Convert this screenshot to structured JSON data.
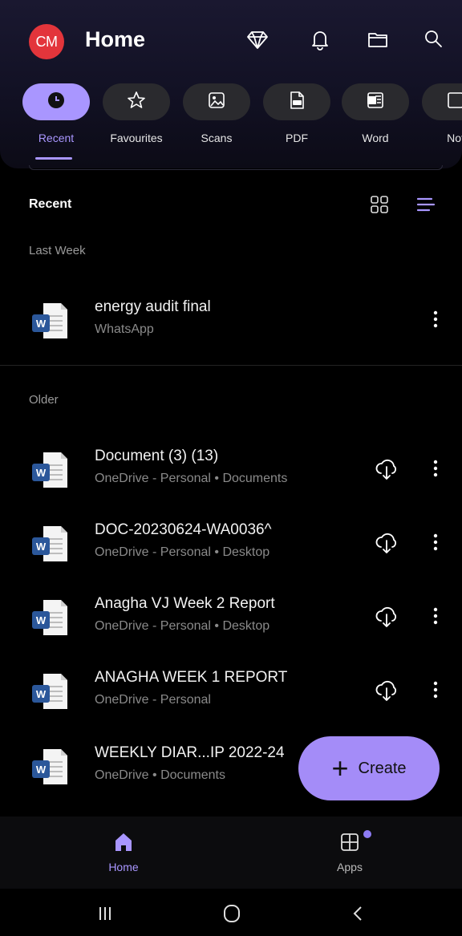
{
  "header": {
    "avatar_initials": "CM",
    "title": "Home",
    "icons": [
      "premium-diamond-icon",
      "bell-icon",
      "folder-icon",
      "search-icon"
    ]
  },
  "categories": [
    {
      "label": "Recent",
      "icon": "clock-icon",
      "active": true
    },
    {
      "label": "Favourites",
      "icon": "star-icon",
      "active": false
    },
    {
      "label": "Scans",
      "icon": "image-icon",
      "active": false
    },
    {
      "label": "PDF",
      "icon": "pdf-icon",
      "active": false
    },
    {
      "label": "Word",
      "icon": "word-icon",
      "active": false
    },
    {
      "label": "Not",
      "icon": "note-icon",
      "active": false
    }
  ],
  "section": {
    "title": "Recent",
    "view_active": "list"
  },
  "groups": [
    {
      "label": "Last Week"
    },
    {
      "label": "Older"
    }
  ],
  "files": [
    {
      "name": "energy audit final",
      "location": "WhatsApp",
      "cloud": false
    },
    {
      "name": "Document (3) (13)",
      "location": "OneDrive - Personal • Documents",
      "cloud": true
    },
    {
      "name": "DOC-20230624-WA0036^",
      "location": "OneDrive - Personal • Desktop",
      "cloud": true
    },
    {
      "name": "Anagha VJ Week 2 Report",
      "location": "OneDrive - Personal • Desktop",
      "cloud": true
    },
    {
      "name": "ANAGHA WEEK 1 REPORT",
      "location": "OneDrive - Personal",
      "cloud": true
    },
    {
      "name": "WEEKLY DIAR...IP 2022-24",
      "location": "OneDrive • Documents",
      "cloud": false
    }
  ],
  "fab": {
    "label": "Create"
  },
  "bottom_nav": [
    {
      "label": "Home",
      "icon": "home-icon",
      "active": true
    },
    {
      "label": "Apps",
      "icon": "apps-icon",
      "active": false,
      "badge": true
    }
  ],
  "colors": {
    "accent": "#a996ff",
    "avatar": "#e3353b",
    "fab": "#a48cf8",
    "word_blue": "#2b579a"
  }
}
